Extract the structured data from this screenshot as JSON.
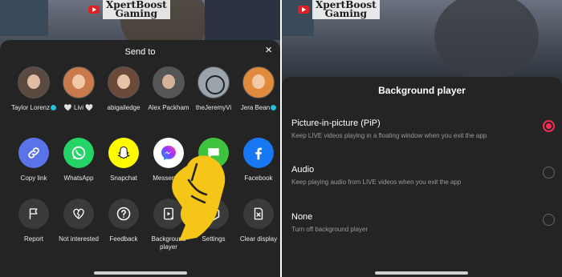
{
  "left": {
    "logo_line1": "XpertBoost",
    "logo_line2": "Gaming",
    "sheet_title": "Send to",
    "close_label": "×",
    "contacts": [
      {
        "name": "Taylor Lorenz",
        "verified": true
      },
      {
        "name": "🤍 Livi 🤍",
        "verified": false
      },
      {
        "name": "abigailedge",
        "verified": false
      },
      {
        "name": "Alex Packham",
        "verified": false
      },
      {
        "name": "theJeremyVi",
        "verified": false
      },
      {
        "name": "Jera Bean",
        "verified": true
      }
    ],
    "share_options": [
      {
        "label": "Copy link",
        "icon": "link-icon",
        "color": "#5b73e8"
      },
      {
        "label": "WhatsApp",
        "icon": "whatsapp-icon",
        "color": "#25d366"
      },
      {
        "label": "Snapchat",
        "icon": "snapchat-icon",
        "color": "#fffc00"
      },
      {
        "label": "Messenger",
        "icon": "messenger-icon",
        "color": "#ffffff"
      },
      {
        "label": "SMS",
        "icon": "sms-icon",
        "color": "#3ec33e"
      },
      {
        "label": "Facebook",
        "icon": "facebook-icon",
        "color": "#1877f2"
      }
    ],
    "actions": [
      {
        "label": "Report",
        "icon": "flag-icon"
      },
      {
        "label": "Not interested",
        "icon": "broken-heart-icon"
      },
      {
        "label": "Feedback",
        "icon": "question-icon"
      },
      {
        "label": "Background player",
        "icon": "background-player-icon"
      },
      {
        "label": "Settings",
        "icon": "settings-icon"
      },
      {
        "label": "Clear display",
        "icon": "clear-display-icon"
      }
    ]
  },
  "right": {
    "logo_line1": "XpertBoost",
    "logo_line2": "Gaming",
    "title": "Background player",
    "options": [
      {
        "title": "Picture-in-picture (PiP)",
        "desc": "Keep LIVE videos playing in a floating window when you exit the app",
        "selected": true
      },
      {
        "title": "Audio",
        "desc": "Keep playing audio from LIVE videos when you exit the app",
        "selected": false
      },
      {
        "title": "None",
        "desc": "Turn off background player",
        "selected": false
      }
    ]
  },
  "colors": {
    "accent": "#fe2c55",
    "sheet": "#242424",
    "hand": "#f5c518"
  }
}
